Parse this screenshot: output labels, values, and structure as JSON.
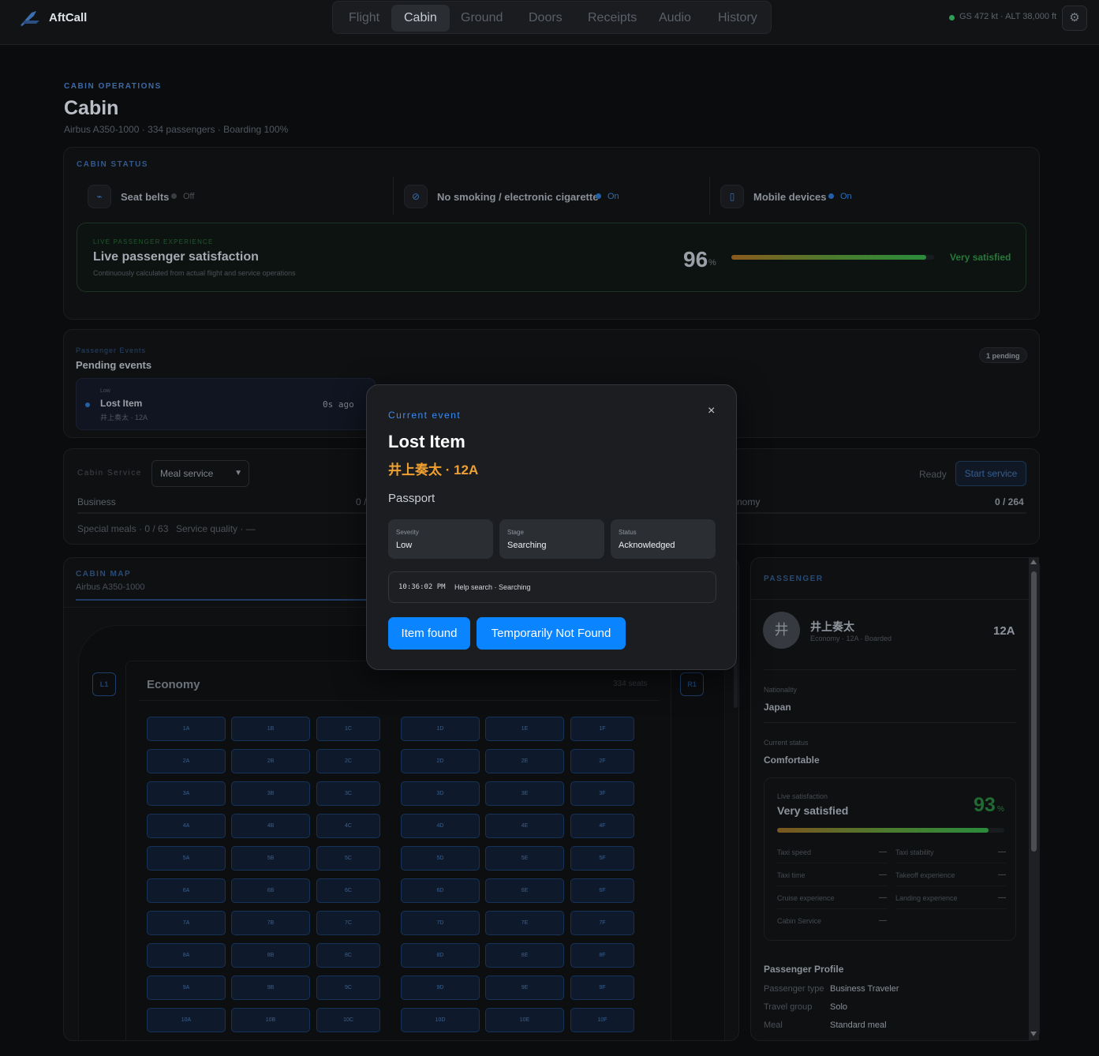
{
  "app": {
    "name": "AftCall",
    "gps": "GS 472 kt · ALT 38,000 ft",
    "settings_icon": "gear-icon"
  },
  "tabs": [
    {
      "label": "Flight",
      "active": false
    },
    {
      "label": "Cabin",
      "active": true
    },
    {
      "label": "Ground",
      "active": false
    },
    {
      "label": "Doors",
      "active": false
    },
    {
      "label": "Receipts",
      "active": false
    },
    {
      "label": "Audio",
      "active": false
    },
    {
      "label": "History",
      "active": false
    }
  ],
  "header": {
    "eyebrow": "CABIN OPERATIONS",
    "title": "Cabin",
    "subtitle": "Airbus A350-1000 · 334 passengers · Boarding 100%"
  },
  "cabin_status": {
    "eyebrow": "CABIN STATUS",
    "switches": [
      {
        "icon": "seatbelt-icon",
        "label": "Seat belts",
        "value": "Off",
        "dot_color": "#3a3d42",
        "value_color": "#4c5259"
      },
      {
        "icon": "no-smoking-icon",
        "label": "No smoking / electronic cigarette",
        "value": "On",
        "dot_color": "#2460a8",
        "value_color": "#2f6db6"
      },
      {
        "icon": "mobile-device-icon",
        "label": "Mobile devices",
        "value": "On",
        "dot_color": "#2460a8",
        "value_color": "#2f6db6"
      }
    ],
    "satisfaction": {
      "eyebrow": "LIVE PASSENGER EXPERIENCE",
      "title": "Live passenger satisfaction",
      "description": "Continuously calculated from actual flight and service operations",
      "score": "96",
      "unit": "%",
      "level": 0.96,
      "word": "Very satisfied"
    }
  },
  "events": {
    "eyebrow": "Passenger Events",
    "title": "Pending events",
    "badge": "1 pending",
    "items": [
      {
        "severity": "Low",
        "name": "Lost Item",
        "who": "井上奏太 · 12A",
        "ago": "0s ago"
      }
    ]
  },
  "service": {
    "eyebrow": "Cabin Service",
    "select_value": "Meal service",
    "ready": "Ready",
    "start_label": "Start service",
    "business_label": "Business",
    "business_value": "0 /",
    "economy_label": "nomy",
    "economy_value": "0 / 264",
    "special_meals": "Special meals · 0 / 63",
    "quality": "Service quality · —"
  },
  "cabin_map": {
    "eyebrow": "CABIN MAP",
    "aircraft": "Airbus A350-1000",
    "exit_left": "L1",
    "exit_right": "R1",
    "section": "Economy",
    "section_seats": "334 seats",
    "rows": [
      "1",
      "2",
      "3",
      "4",
      "5",
      "6",
      "7",
      "8",
      "9",
      "10"
    ],
    "letters": [
      "A",
      "B",
      "C",
      "D",
      "E",
      "F"
    ]
  },
  "passenger": {
    "eyebrow": "PASSENGER",
    "avatar": "井",
    "name": "井上奏太",
    "meta": "Economy · 12A · Boarded",
    "seat": "12A",
    "nationality_label": "Nationality",
    "nationality": "Japan",
    "status_label": "Current status",
    "status": "Comfortable",
    "sat_label": "Live satisfaction",
    "sat_word": "Very satisfied",
    "sat_score": "93",
    "sat_unit": "%",
    "sat_level": 0.93,
    "metrics": [
      {
        "label": "Taxi speed",
        "value": "—"
      },
      {
        "label": "Taxi stability",
        "value": "—"
      },
      {
        "label": "Taxi time",
        "value": "—"
      },
      {
        "label": "Takeoff experience",
        "value": "—"
      },
      {
        "label": "Cruise experience",
        "value": "—"
      },
      {
        "label": "Landing experience",
        "value": "—"
      },
      {
        "label": "Cabin Service",
        "value": "—"
      }
    ],
    "profile_title": "Passenger Profile",
    "profile": [
      {
        "label": "Passenger type",
        "value": "Business Traveler"
      },
      {
        "label": "Travel group",
        "value": "Solo"
      },
      {
        "label": "Meal",
        "value": "Standard meal"
      }
    ]
  },
  "modal": {
    "eyebrow": "Current event",
    "title": "Lost Item",
    "subtitle": "井上奏太 · 12A",
    "item": "Passport",
    "chips": [
      {
        "label": "Severity",
        "value": "Low"
      },
      {
        "label": "Stage",
        "value": "Searching"
      },
      {
        "label": "Status",
        "value": "Acknowledged"
      }
    ],
    "log_time": "10:36:02 PM",
    "log_message": "Help search · Searching",
    "primary_label": "Item found",
    "secondary_label": "Temporarily Not Found",
    "close": "×"
  }
}
